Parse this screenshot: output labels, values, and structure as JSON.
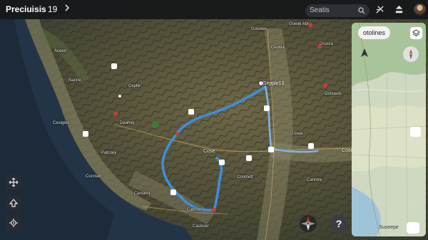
{
  "header": {
    "title": "Preciuisis",
    "count": "19",
    "search_placeholder": "Seatis"
  },
  "icons": {
    "chevron": "chevron-right-icon",
    "search": "search-icon",
    "route_tool": "route-tool-icon",
    "upload": "upload-icon",
    "recenter": "recenter-icon",
    "terrain": "terrain-icon",
    "settings": "settings-icon",
    "compass": "compass-icon",
    "help": "help-icon"
  },
  "map": {
    "places": [
      "Gepple13",
      "Cose",
      "Cose"
    ],
    "labels": [
      "Goeile Abr",
      "Aceerl",
      "Drosca",
      "Gosstes",
      "Ceoltia",
      "Deahey",
      "Cesigtes",
      "Palcriey",
      "Cansenr",
      "Gotiseds",
      "Ureet",
      "Ceplle",
      "Conmett",
      "Catrore",
      "Nanne",
      "Canntre",
      "Cocrsen",
      "Caslorer"
    ],
    "help_label": "?"
  },
  "inset": {
    "title": "otolines",
    "bottom_label": "Suseepe"
  },
  "colors": {
    "route": "#3d8ee0",
    "topbar": "#141619",
    "compass_red": "#d23a2f"
  }
}
